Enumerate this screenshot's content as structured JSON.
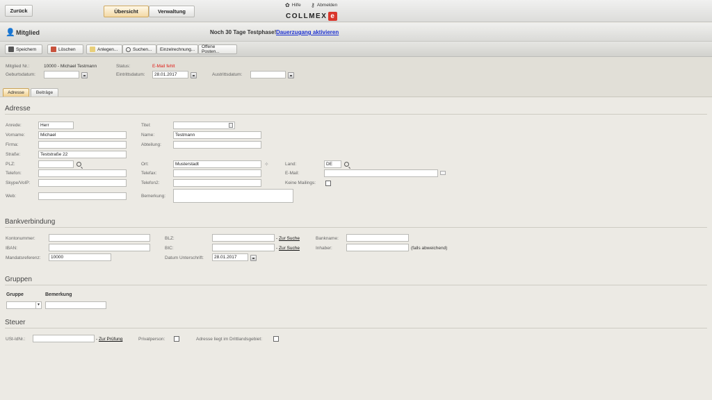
{
  "topbar": {
    "back_label": "Zurück",
    "tab_overview": "Übersicht",
    "tab_admin": "Verwaltung",
    "help": "Hilfe",
    "logout": "Abmelden",
    "logo": "COLLMEX"
  },
  "titlebar": {
    "title": "Mitglied",
    "trial_text": "Noch 30 Tage Testphase!",
    "trial_link": "Dauerzugang aktivieren"
  },
  "toolbar": {
    "save": "Speichern",
    "delete": "Löschen",
    "create": "Anlegen...",
    "search": "Suchen...",
    "single_invoice": "Einzelrechnung...",
    "open_items": "Offene Posten..."
  },
  "info": {
    "member_no_label": "Mitglied Nr.:",
    "member_no_value": "10000 - Michael Testmann",
    "status_label": "Status:",
    "status_value": "E-Mail fehlt",
    "status_color": "#e0201b",
    "birth_label": "Geburtsdatum:",
    "birth_value": "",
    "entry_label": "Eintrittsdatum:",
    "entry_value": "28.01.2017",
    "exit_label": "Austrittsdatum:",
    "exit_value": ""
  },
  "tabs": {
    "address": "Adresse",
    "fees": "Beiträge"
  },
  "address": {
    "heading": "Adresse",
    "salutation_label": "Anrede:",
    "salutation": "Herr",
    "title_label": "Titel:",
    "title": "",
    "firstname_label": "Vorname:",
    "firstname": "Michael",
    "name_label": "Name:",
    "name": "Testmann",
    "company_label": "Firma:",
    "company": "",
    "department_label": "Abteilung:",
    "department": "",
    "street_label": "Straße:",
    "street": "Teststraße 22",
    "zip_label": "PLZ:",
    "zip": "",
    "city_label": "Ort:",
    "city": "Musterstadt",
    "country_label": "Land:",
    "country": "DE",
    "phone_label": "Telefon:",
    "phone": "",
    "fax_label": "Telefax:",
    "fax": "",
    "email_label": "E-Mail:",
    "email": "",
    "skype_label": "Skype/VoIP:",
    "skype": "",
    "phone2_label": "Telefon2:",
    "phone2": "",
    "no_mailings_label": "Keine Mailings:",
    "web_label": "Web:",
    "web": "",
    "remark_label": "Bemerkung:",
    "remark": ""
  },
  "bank": {
    "heading": "Bankverbindung",
    "account_label": "Kontonummer:",
    "account": "",
    "blz_label": "BLZ:",
    "blz": "",
    "blz_search": "Zur Suche",
    "bankname_label": "Bankname:",
    "bankname": "",
    "iban_label": "IBAN:",
    "iban": "",
    "bic_label": "BIC:",
    "bic": "",
    "bic_search": "Zur Suche",
    "holder_label": "Inhaber:",
    "holder": "",
    "holder_note": "(falls abweichend)",
    "mandate_label": "Mandatsreferenz:",
    "mandate": "10000",
    "signature_date_label": "Datum Unterschrift:",
    "signature_date": "28.01.2017"
  },
  "groups": {
    "heading": "Gruppen",
    "col_group": "Gruppe",
    "col_remark": "Bemerkung",
    "remark": ""
  },
  "tax": {
    "heading": "Steuer",
    "vat_label": "USt-IdNr.:",
    "vat": "",
    "vat_check": "Zur Prüfung",
    "private_label": "Privatperson:",
    "third_country_label": "Adresse liegt im Drittlandsgebiet:"
  }
}
